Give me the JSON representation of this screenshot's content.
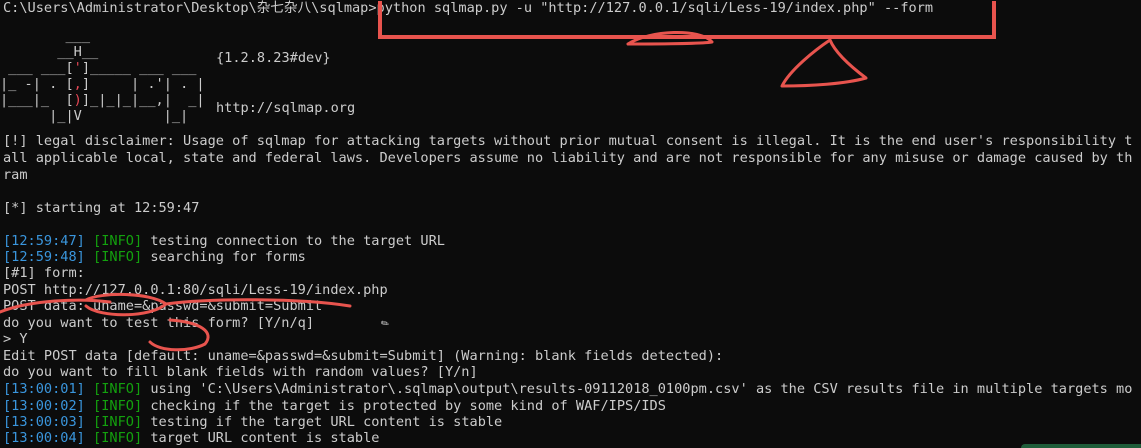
{
  "terminal": {
    "command_line": "C:\\Users\\Administrator\\Desktop\\杂七杂八\\sqlmap>python sqlmap.py -u \"http://127.0.0.1/sqli/Less-19/index.php\" --form",
    "logo": {
      "version": "{1.2.8.23#dev}",
      "url": "http://sqlmap.org"
    },
    "disclaimer": [
      "[!] legal disclaimer: Usage of sqlmap for attacking targets without prior mutual consent is illegal. It is the end user's responsibility t",
      "all applicable local, state and federal laws. Developers assume no liability and are not responsible for any misuse or damage caused by th",
      "ram"
    ],
    "starting": "[*] starting at 12:59:47",
    "log": [
      {
        "time": "[12:59:47]",
        "tag": "[INFO]",
        "msg": " testing connection to the target URL"
      },
      {
        "time": "[12:59:48]",
        "tag": "[INFO]",
        "msg": " searching for forms"
      }
    ],
    "form_lines": [
      "[#1] form:",
      "POST http://127.0.0.1:80/sqli/Less-19/index.php",
      "POST data: uname=&passwd=&submit=Submit",
      "do you want to test this form? [Y/n/q]",
      "> Y",
      "Edit POST data [default: uname=&passwd=&submit=Submit] (Warning: blank fields detected):",
      "do you want to fill blank fields with random values? [Y/n]"
    ],
    "log2": [
      {
        "time": "[13:00:01]",
        "tag": "[INFO]",
        "msg": " using 'C:\\Users\\Administrator\\.sqlmap\\output\\results-09112018_0100pm.csv' as the CSV results file in multiple targets mo"
      },
      {
        "time": "[13:00:02]",
        "tag": "[INFO]",
        "msg": " checking if the target is protected by some kind of WAF/IPS/IDS"
      },
      {
        "time": "[13:00:03]",
        "tag": "[INFO]",
        "msg": " testing if the target URL content is stable"
      },
      {
        "time": "[13:00:04]",
        "tag": "[INFO]",
        "msg": " target URL content is stable"
      }
    ]
  },
  "colors": {
    "background": "#0c0c0c",
    "text": "#cccccc",
    "timestamp": "#3a96dd",
    "info_tag": "#13a10e",
    "annotation_red": "#e8544e"
  }
}
